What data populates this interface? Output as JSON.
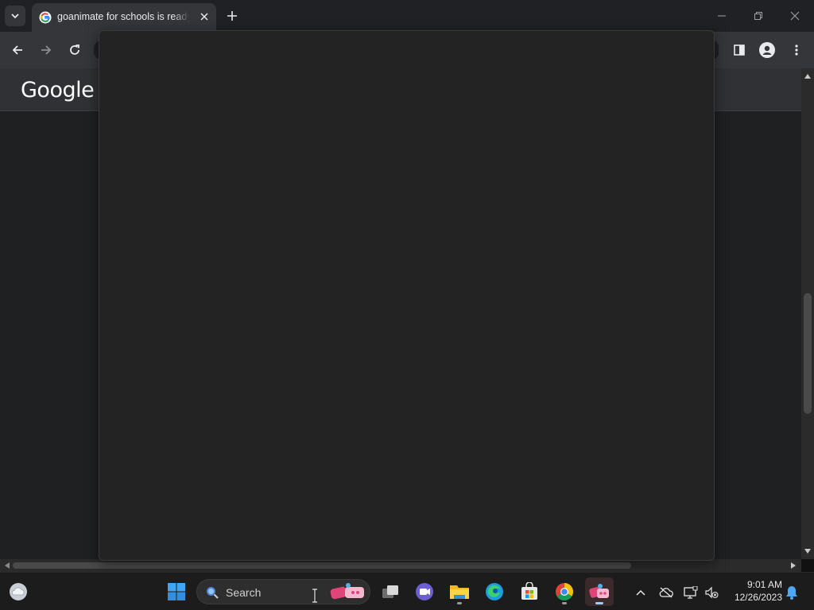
{
  "browser": {
    "tab": {
      "title": "goanimate for schools is ready"
    },
    "window_controls": [
      "minimize",
      "restore",
      "close"
    ]
  },
  "page": {
    "logo_text": "Google"
  },
  "taskbar": {
    "search_label": "Search",
    "apps": [
      "start-icon",
      "task-view-icon",
      "chat-icon",
      "file-explorer-icon",
      "edge-icon",
      "store-icon",
      "chrome-icon",
      "comet-app-icon"
    ],
    "clock": {
      "time": "9:01 AM",
      "date": "12/26/2023"
    }
  },
  "colors": {
    "tab_active": "#35363a",
    "chrome_frame": "#202124",
    "taskbar": "#1c1c1c",
    "overlay": "#232323"
  }
}
